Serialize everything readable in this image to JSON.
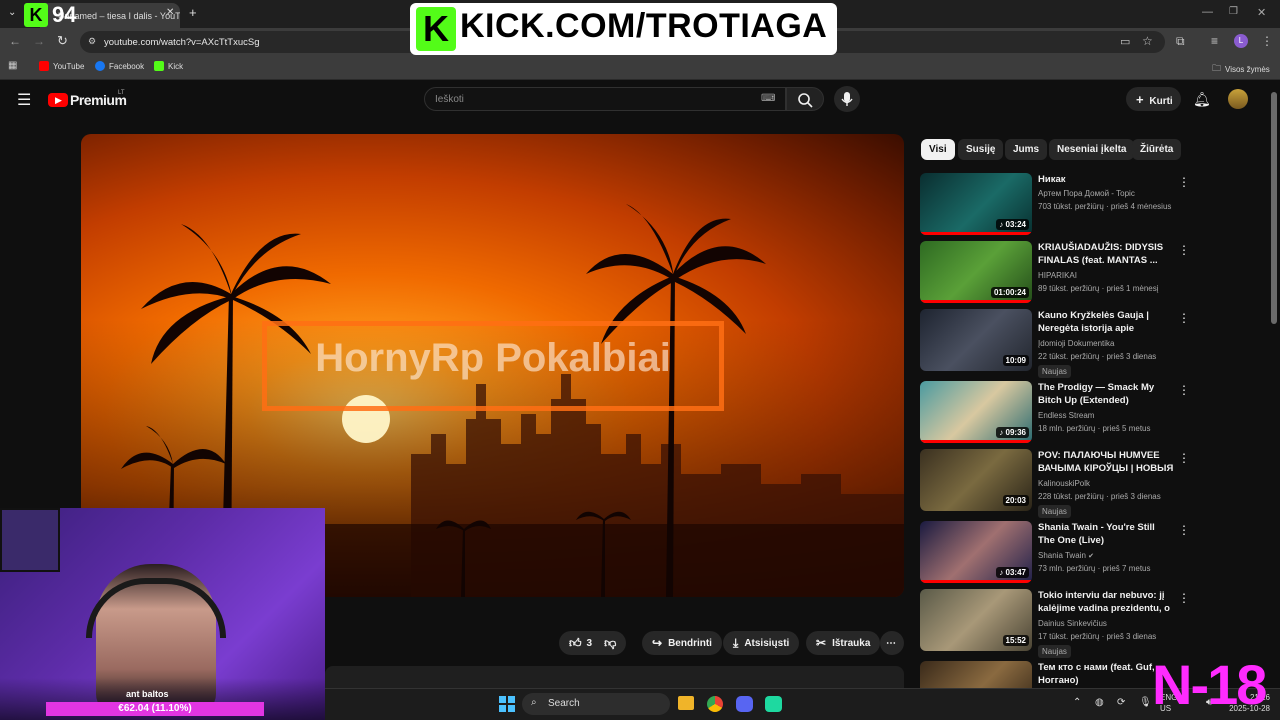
{
  "browser": {
    "tab_title": "Unnamed – tiesa I dalis - YouTube",
    "url": "youtube.com/watch?v=AXcTtTxucSg",
    "bookmarks": [
      {
        "label": "YouTube",
        "color": "#ff0000"
      },
      {
        "label": "Facebook",
        "color": "#1877f2"
      },
      {
        "label": "Kick",
        "color": "#53fc18"
      }
    ],
    "other_bookmarks": "Visos žymės",
    "profile_initial": "L"
  },
  "youtube": {
    "logo_text": "Premium",
    "logo_region": "LT",
    "search_placeholder": "Ieškoti",
    "create_label": "Kurti",
    "video_title_overlay": "HornyRp Pokalbiai",
    "actions": {
      "like_count": "3",
      "share": "Bendrinti",
      "download": "Atsisiųsti",
      "clip": "Ištrauka"
    },
    "chips": [
      "Visi",
      "Susiję",
      "Jums",
      "Neseniai įkelta",
      "Žiūrėta"
    ],
    "recommendations": [
      {
        "title": "Никак",
        "channel": "Артем Пора Домой - Topic",
        "meta": "703 tūkst. peržiūrų · prieš 4 mėnesius",
        "duration": "03:24",
        "badge": "",
        "thumb_color": "#0e4a48"
      },
      {
        "title": "KRIAUŠIADAUŽIS: DIDYSIS FINALAS (feat. MANTAS ...",
        "channel": "HIPARIKAI",
        "meta": "89 tūkst. peržiūrų · prieš 1 mėnesį",
        "duration": "01:00:24",
        "badge": "",
        "thumb_color": "#3d6a2a"
      },
      {
        "title": "Kauno Kryžkelės Gauja | Neregėta istorija apie Lietuvos...",
        "channel": "Įdomioji Dokumentika",
        "meta": "22 tūkst. peržiūrų · prieš 3 dienas",
        "duration": "10:09",
        "badge": "Naujas",
        "thumb_color": "#2f3540"
      },
      {
        "title": "The Prodigy — Smack My Bitch Up (Extended)",
        "channel": "Endless Stream",
        "meta": "18 mln. peržiūrų · prieš 5 metus",
        "duration": "09:36",
        "badge": "",
        "thumb_color": "#3a7a80"
      },
      {
        "title": "POV: ПАЛАЮЧЫ HUMVEE ВАЧЫМА КІРОЎЦЫ | НОВЫЯ ...",
        "channel": "KalinouskiPolk",
        "meta": "228 tūkst. peržiūrų · prieš 3 dienas",
        "duration": "20:03",
        "badge": "Naujas",
        "thumb_color": "#5a4a30"
      },
      {
        "title": "Shania Twain - You're Still The One (Live)",
        "channel": "Shania Twain",
        "meta": "73 mln. peržiūrų · prieš 7 metus",
        "duration": "03:47",
        "badge": "",
        "thumb_color": "#2a2a5a"
      },
      {
        "title": "Tokio interviu dar nebuvo: jį kalėjime vadina prezidentu, o ...",
        "channel": "Dainius Sinkevičius",
        "meta": "17 tūkst. peržiūrų · prieš 3 dienas",
        "duration": "15:52",
        "badge": "Naujas",
        "thumb_color": "#6a6050"
      },
      {
        "title": "Тем кто с нами (feat. Guf, Ноггано)",
        "channel": "",
        "meta": "",
        "duration": "",
        "badge": "",
        "thumb_color": "#4a3a2a"
      }
    ]
  },
  "overlay": {
    "kick_banner": "KICK.COM/TROTIAGA",
    "viewer_count": "94",
    "cam_name": "ant baltos",
    "cam_bar": "€62.04 (11.10%)",
    "age_rating": "N-18"
  },
  "taskbar": {
    "search_label": "Search",
    "lang_top": "ENG",
    "lang_bottom": "US",
    "time": "21:16",
    "date": "2025-10-28"
  },
  "colors": {
    "youtube_red": "#ff0000",
    "kick_green": "#53fc18",
    "overlay_magenta": "#ff2bff"
  }
}
